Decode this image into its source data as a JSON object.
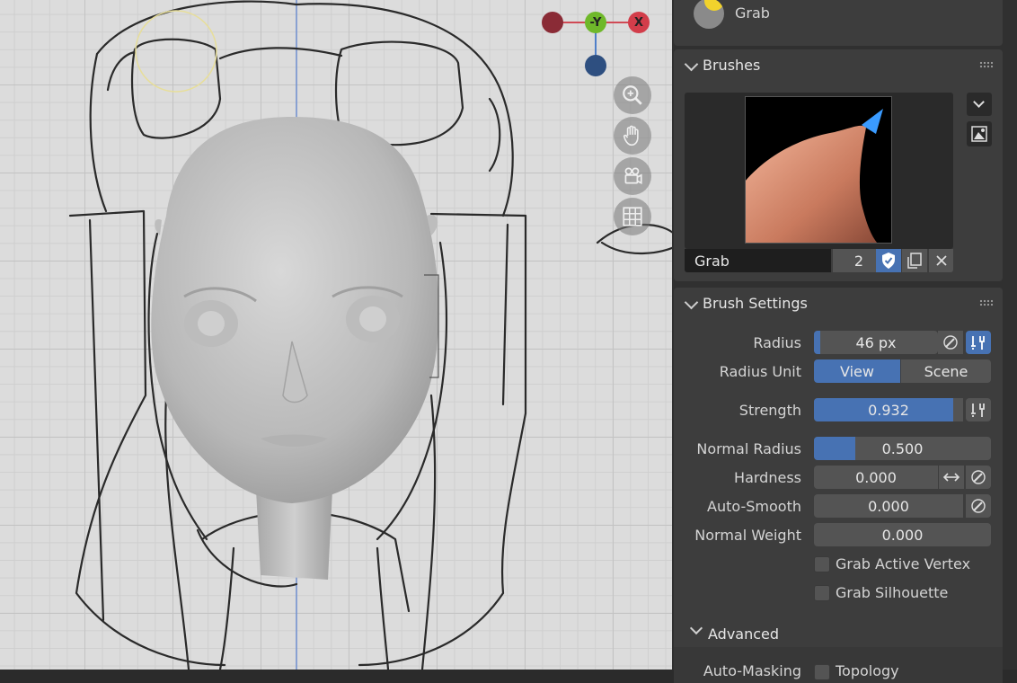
{
  "viewport": {
    "gizmo": {
      "y_label": "-Y",
      "x_label": "X"
    },
    "nav_buttons": [
      "zoom-icon",
      "hand-pan-icon",
      "camera-icon",
      "grid-icon"
    ]
  },
  "tool_panel": {
    "tool_name": "Grab"
  },
  "brushes_panel": {
    "title": "Brushes",
    "brush_name": "Grab",
    "user_count": "2"
  },
  "brush_settings": {
    "title": "Brush Settings",
    "radius_label": "Radius",
    "radius_value": "46 px",
    "radius_fill": 0.05,
    "radius_unit_label": "Radius Unit",
    "radius_unit_options": [
      "View",
      "Scene"
    ],
    "radius_unit_selected": "View",
    "strength_label": "Strength",
    "strength_value": "0.932",
    "strength_fill": 0.932,
    "normal_radius_label": "Normal Radius",
    "normal_radius_value": "0.500",
    "normal_radius_fill": 0.25,
    "hardness_label": "Hardness",
    "hardness_value": "0.000",
    "auto_smooth_label": "Auto-Smooth",
    "auto_smooth_value": "0.000",
    "normal_weight_label": "Normal Weight",
    "normal_weight_value": "0.000",
    "grab_active_vertex_label": "Grab Active Vertex",
    "grab_silhouette_label": "Grab Silhouette",
    "advanced_label": "Advanced",
    "auto_masking_label": "Auto-Masking",
    "auto_masking_option": "Topology"
  },
  "colors": {
    "accent": "#4772b3",
    "panel": "#3d3d3d",
    "field": "#545454"
  }
}
